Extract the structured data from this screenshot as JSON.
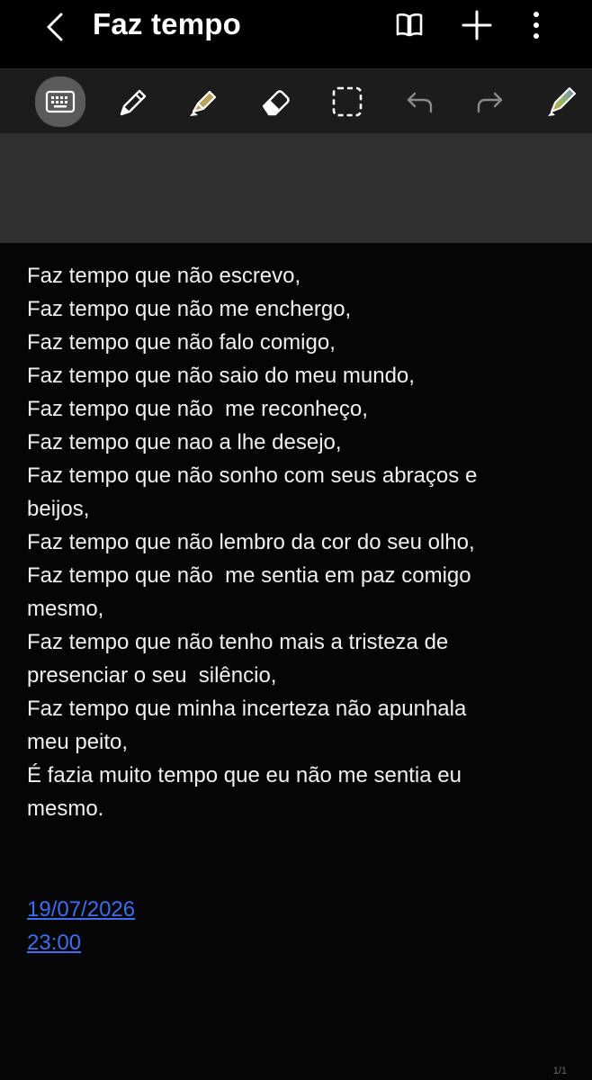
{
  "header": {
    "title": "Faz tempo",
    "icons": [
      "back-chevron-icon",
      "book-view-icon",
      "add-icon",
      "more-vert-icon"
    ]
  },
  "toolbar": {
    "tools": [
      "keyboard-icon",
      "pen-icon",
      "highlighter-icon",
      "eraser-icon",
      "selection-icon",
      "undo-icon",
      "redo-icon",
      "pen-settings-icon"
    ],
    "active_tool": "keyboard-icon"
  },
  "note": {
    "lines": [
      "Faz tempo que não escrevo,",
      "Faz tempo que não me enchergo,",
      "Faz tempo que não falo comigo,",
      "Faz tempo que não saio do meu mundo,",
      "Faz tempo que não  me reconheço,",
      "Faz tempo que nao a lhe desejo,",
      "Faz tempo que não sonho com seus abraços e",
      "beijos,",
      "Faz tempo que não lembro da cor do seu olho,",
      "Faz tempo que não  me sentia em paz comigo",
      "mesmo,",
      "Faz tempo que não tenho mais a tristeza de",
      "presenciar o seu  silêncio,",
      "Faz tempo que minha incerteza não apunhala",
      "meu peito,",
      "É fazia muito tempo que eu não me sentia eu",
      "mesmo."
    ],
    "date_link": "19/07/2026",
    "time_link": "23:00"
  },
  "page_indicator": "1/1",
  "colors": {
    "background": "#050505",
    "toolbar": "#1c1c1c",
    "banner": "#2f2f30",
    "link": "#3c6ff0",
    "highlighter": "#b8a25a"
  }
}
